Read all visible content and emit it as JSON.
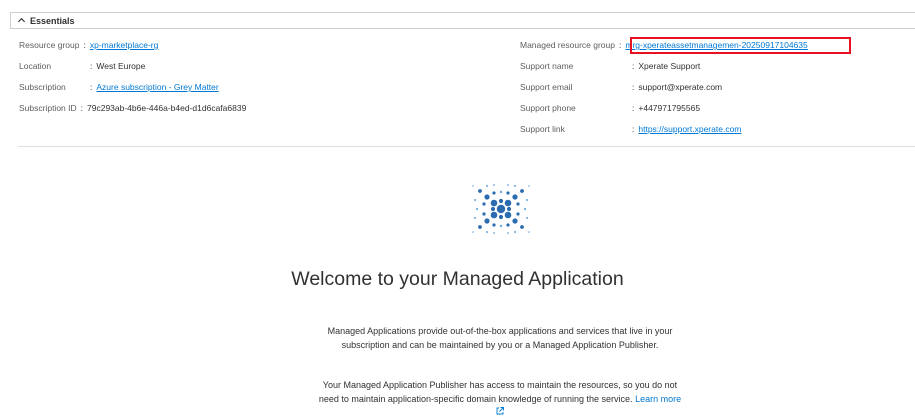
{
  "essentials": {
    "title": "Essentials",
    "left": [
      {
        "label": "Resource group",
        "value": "xp-marketplace-rg",
        "link": true
      },
      {
        "label": "Location",
        "value": "West Europe",
        "link": false
      },
      {
        "label": "Subscription",
        "value": "Azure subscription - Grey Matter",
        "link": true
      },
      {
        "label": "Subscription ID",
        "value": "79c293ab-4b6e-446a-b4ed-d1d6cafa6839",
        "link": false
      }
    ],
    "right": [
      {
        "label": "Managed resource group",
        "value": "mrg-xperateassetmanagemen-20250917104635",
        "link": true
      },
      {
        "label": "Support name",
        "value": "Xperate Support",
        "link": false
      },
      {
        "label": "Support email",
        "value": "support@xperate.com",
        "link": false
      },
      {
        "label": "Support phone",
        "value": "+447971795565",
        "link": false
      },
      {
        "label": "Support link",
        "value": "https://support.xperate.com",
        "link": true
      }
    ],
    "separator": ":"
  },
  "welcome": {
    "title": "Welcome to your Managed Application",
    "para1_line1": "Managed Applications provide out-of-the-box applications and services that live in your",
    "para1_line2": "subscription and can be maintained by you or a Managed Application Publisher.",
    "para2_line1": "Your Managed Application Publisher has access to maintain the resources, so you do not",
    "para2_line2": "need to maintain application-specific domain knowledge of running the service.",
    "learn_more": "Learn more"
  },
  "colors": {
    "link": "#0078d4",
    "highlight": "#e81123",
    "logo": "#2b6cb0"
  },
  "icons": [
    "chevron-up-icon",
    "managed-app-logo",
    "external-link-icon"
  ]
}
